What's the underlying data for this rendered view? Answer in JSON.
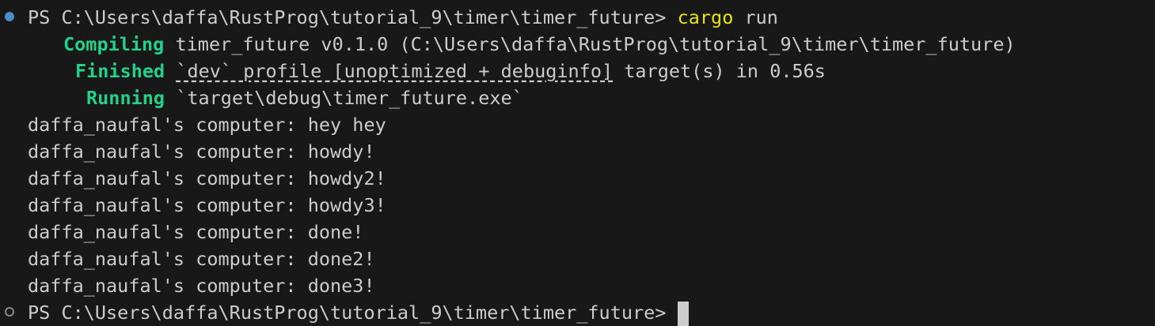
{
  "terminal": {
    "prompt_path": "PS C:\\Users\\daffa\\RustProg\\tutorial_9\\timer\\timer_future>",
    "command_prog": "cargo",
    "command_args": "run",
    "compiling_label": "Compiling",
    "compiling_text": "timer_future v0.1.0 (C:\\Users\\daffa\\RustProg\\tutorial_9\\timer\\timer_future)",
    "finished_label": "Finished",
    "finished_profile": "`dev` profile [unoptimized + debuginfo]",
    "finished_rest": "target(s) in 0.56s",
    "running_label": "Running",
    "running_text": "`target\\debug\\timer_future.exe`",
    "output": [
      "daffa_naufal's computer: hey hey",
      "daffa_naufal's computer: howdy!",
      "daffa_naufal's computer: howdy2!",
      "daffa_naufal's computer: howdy3!",
      "daffa_naufal's computer: done!",
      "daffa_naufal's computer: done2!",
      "daffa_naufal's computer: done3!"
    ],
    "final_prompt": "PS C:\\Users\\daffa\\RustProg\\tutorial_9\\timer\\timer_future>"
  },
  "colors": {
    "background": "#181818",
    "text": "#cccccc",
    "command": "#e5e510",
    "status_green": "#23d18b",
    "success_decoration": "#4a8cc9"
  }
}
